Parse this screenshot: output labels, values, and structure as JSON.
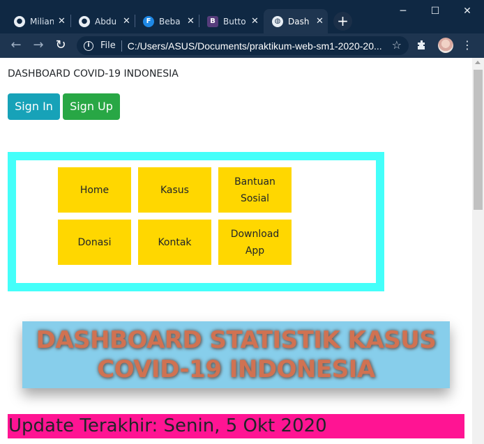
{
  "browser": {
    "tabs": [
      {
        "title": "Milian",
        "favicon": "github-icon",
        "active": false
      },
      {
        "title": "Abdu",
        "favicon": "github-icon",
        "active": false
      },
      {
        "title": "Beba",
        "favicon": "f-icon",
        "active": false
      },
      {
        "title": "Butto",
        "favicon": "bootstrap-icon",
        "active": false
      },
      {
        "title": "Dash",
        "favicon": "globe-icon",
        "active": true
      }
    ],
    "scheme_label": "File",
    "url": "C:/Users/ASUS/Documents/praktikum-web-sm1-2020-20..."
  },
  "page": {
    "heading": "DASHBOARD COVID-19 INDONESIA",
    "buttons": {
      "sign_in": "Sign In",
      "sign_up": "Sign Up"
    },
    "menu": [
      {
        "line1": "Home",
        "line2": ""
      },
      {
        "line1": "Kasus",
        "line2": ""
      },
      {
        "line1": "Bantuan",
        "line2": "Sosial"
      },
      {
        "line1": "Donasi",
        "line2": ""
      },
      {
        "line1": "Kontak",
        "line2": ""
      },
      {
        "line1": "Download",
        "line2": "App"
      }
    ],
    "banner": {
      "line1": "DASHBOARD STATISTIK KASUS",
      "line2": "COVID-19 INDONESIA"
    },
    "update": "Update Terakhir: Senin, 5 Okt 2020"
  },
  "colors": {
    "chrome_dark": "#0f2843",
    "chrome_toolbar": "#1e3550",
    "sign_in": "#17a2b8",
    "sign_up": "#28a745",
    "menu_border": "#44fffa",
    "menu_item": "#ffd700",
    "banner_bg": "#87ceeb",
    "banner_text": "#d07252",
    "update_bg": "#ff1493"
  }
}
